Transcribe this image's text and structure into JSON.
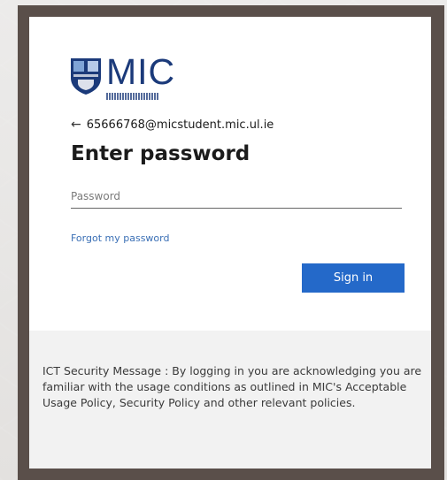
{
  "brand": {
    "logo_text": "MIC"
  },
  "login": {
    "account_email": "65666768@micstudent.mic.ul.ie",
    "title": "Enter password",
    "password_placeholder": "Password",
    "forgot_link": "Forgot my password",
    "signin_label": "Sign in"
  },
  "footer": {
    "message": "ICT Security Message : By logging in you are acknowledging you are familiar with the usage conditions as outlined in MIC's Acceptable Usage Policy, Security Policy and other relevant policies."
  },
  "colors": {
    "primary": "#2469c9",
    "brand": "#1b3a7a",
    "link": "#3a6fb5"
  }
}
